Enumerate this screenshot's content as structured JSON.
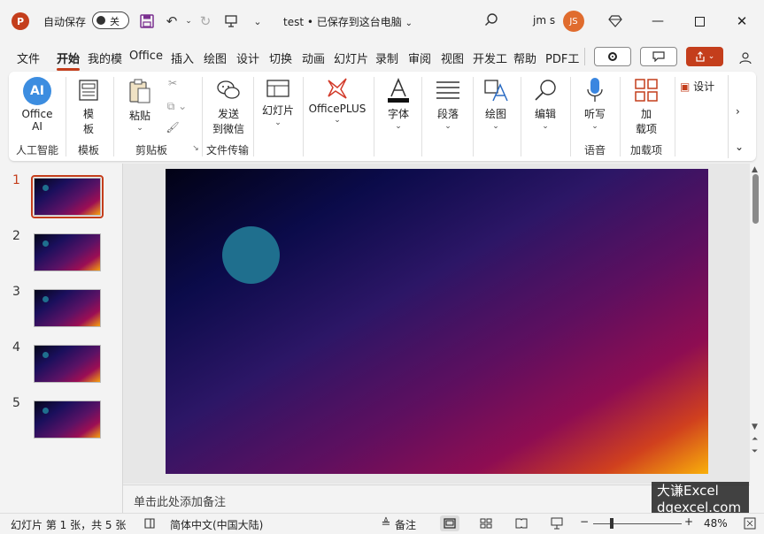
{
  "titlebar": {
    "autosave_label": "自动保存",
    "autosave_state": "关",
    "doc_title": "test • 已保存到这台电脑",
    "user_name": "jm s",
    "user_initials": "JS"
  },
  "tabs": [
    "文件",
    "开始",
    "我的模",
    "Office",
    "插入",
    "绘图",
    "设计",
    "切换",
    "动画",
    "幻灯片",
    "录制",
    "审阅",
    "视图",
    "开发工",
    "帮助",
    "PDF工"
  ],
  "active_tab": "开始",
  "ribbon": {
    "office_ai": {
      "line1": "Office",
      "line2": "AI",
      "group": "人工智能"
    },
    "template": {
      "line1": "模",
      "line2": "板",
      "group": "模板"
    },
    "paste": {
      "label": "粘贴",
      "group": "剪贴板"
    },
    "send_wechat": {
      "line1": "发送",
      "line2": "到微信",
      "group": "文件传输"
    },
    "slides": {
      "label": "幻灯片"
    },
    "officeplus": {
      "label": "OfficePLUS"
    },
    "font": {
      "label": "字体"
    },
    "paragraph": {
      "label": "段落"
    },
    "drawing": {
      "label": "绘图"
    },
    "editing": {
      "label": "编辑"
    },
    "dictate": {
      "label": "听写",
      "group": "语音"
    },
    "addins": {
      "line1": "加",
      "line2": "载项",
      "group": "加载项"
    },
    "designer": {
      "label": "设计"
    }
  },
  "thumbnails": [
    "1",
    "2",
    "3",
    "4",
    "5"
  ],
  "notes_placeholder": "单击此处添加备注",
  "watermark": {
    "line1": "大谦Excel",
    "line2": "dqexcel.com"
  },
  "statusbar": {
    "slide_info": "幻灯片 第 1 张，共 5 张",
    "language": "简体中文(中国大陆)",
    "notes_label": "备注",
    "zoom_minus": "−",
    "zoom_plus": "+",
    "zoom_level": "48%"
  },
  "colors": {
    "accent": "#c43e1c",
    "avatar": "#e06c2e",
    "slide_circle": "#1f6f8e"
  }
}
